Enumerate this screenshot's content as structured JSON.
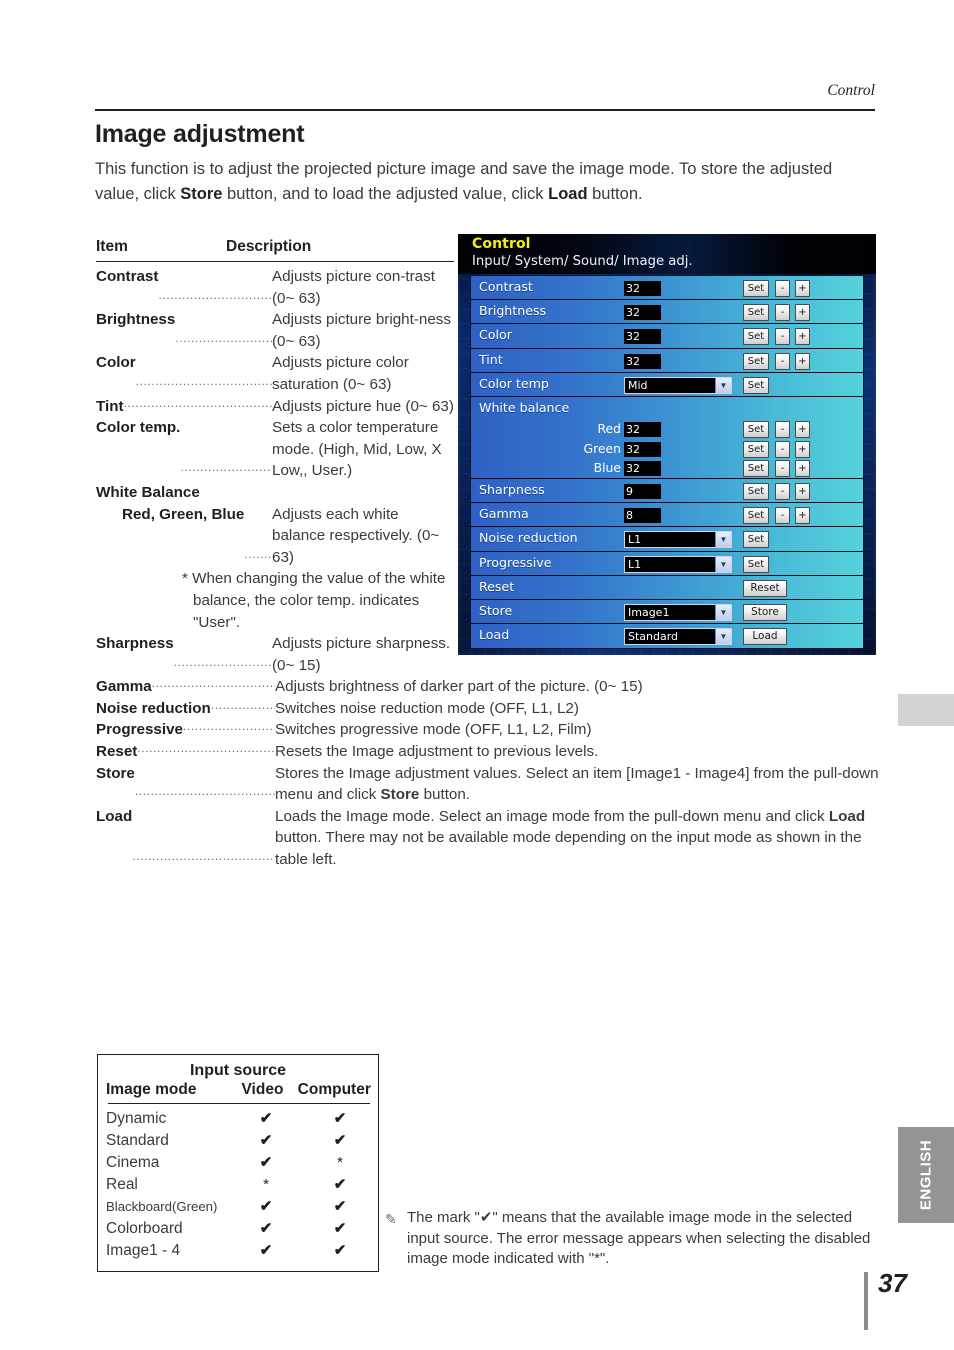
{
  "running_header": "Control",
  "page_title": "Image  adjustment",
  "intro": {
    "part1": "This function is to adjust the projected picture image and save the image mode. To store the adjusted value, click ",
    "store_bold": "Store",
    "part2": " button, and to load the adjusted value, click ",
    "load_bold": "Load",
    "part3": " button."
  },
  "desc_table": {
    "header_item": "Item",
    "header_description": "Description",
    "rows_a": [
      {
        "item": "Contrast",
        "desc": "Adjusts picture con-trast (0~ 63)"
      },
      {
        "item": "Brightness",
        "desc": "Adjusts picture bright-ness (0~ 63)"
      },
      {
        "item": "Color",
        "desc": "Adjusts picture color saturation (0~ 63)"
      },
      {
        "item": "Tint",
        "desc": "Adjusts picture hue (0~ 63)"
      },
      {
        "item": "Color temp.",
        "desc": "Sets a color temperature mode. (High, Mid, Low, X Low,, User.)"
      }
    ],
    "white_balance_head": "White Balance",
    "white_balance_sub_item": "Red, Green, Blue",
    "white_balance_desc": "Adjusts each white balance respectively. (0~ 63)",
    "white_balance_note": "* When changing the value of the white balance, the color temp. indicates \"User\".",
    "rows_b": [
      {
        "item": "Sharpness",
        "desc": "Adjusts picture sharpness. (0~ 15)"
      },
      {
        "item": "Gamma",
        "desc": "Adjusts brightness of darker part of the picture. (0~ 15)"
      },
      {
        "item": "Noise reduction",
        "desc": "Switches noise reduction mode (OFF, L1, L2)"
      },
      {
        "item": "Progressive",
        "desc": "Switches progressive mode (OFF, L1, L2, Film)"
      },
      {
        "item": "Reset",
        "desc": "Resets the Image adjustment to previous levels."
      }
    ],
    "store_row": {
      "item": "Store",
      "part1": "Stores the Image adjustment values. Select an item [Image1 - Image4] from the pull-down menu and click ",
      "bold": "Store",
      "part2": " button."
    },
    "load_row": {
      "item": "Load",
      "part1": "Loads the Image mode. Select an image mode from the pull-down menu and click ",
      "bold": "Load",
      "part2": " button. There may not be available mode depending on the input mode as shown in the table left."
    }
  },
  "panel": {
    "title": "Control",
    "subtitle": "Input/ System/ Sound/ Image adj.",
    "set_label": "Set",
    "minus_label": "-",
    "plus_label": "+",
    "rows": [
      {
        "label": "Contrast",
        "value": "32"
      },
      {
        "label": "Brightness",
        "value": "32"
      },
      {
        "label": "Color",
        "value": "32"
      },
      {
        "label": "Tint",
        "value": "32"
      }
    ],
    "color_temp": {
      "label": "Color temp",
      "value": "Mid"
    },
    "white_balance": {
      "label": "White balance",
      "channels": [
        {
          "label": "Red",
          "value": "32"
        },
        {
          "label": "Green",
          "value": "32"
        },
        {
          "label": "Blue",
          "value": "32"
        }
      ]
    },
    "sharpness": {
      "label": "Sharpness",
      "value": "9"
    },
    "gamma": {
      "label": "Gamma",
      "value": "8"
    },
    "noise_reduction": {
      "label": "Noise reduction",
      "value": "L1"
    },
    "progressive": {
      "label": "Progressive",
      "value": "L1"
    },
    "reset": {
      "label": "Reset",
      "button": "Reset"
    },
    "store": {
      "label": "Store",
      "value": "Image1",
      "button": "Store"
    },
    "load": {
      "label": "Load",
      "value": "Standard",
      "button": "Load"
    }
  },
  "source_table": {
    "title": "Input source",
    "col_mode": "Image mode",
    "col_video": "Video",
    "col_computer": "Computer",
    "check": "✔",
    "star": "*",
    "rows": [
      {
        "mode": "Dynamic",
        "video": "✔",
        "computer": "✔",
        "small": false
      },
      {
        "mode": "Standard",
        "video": "✔",
        "computer": "✔",
        "small": false
      },
      {
        "mode": "Cinema",
        "video": "✔",
        "computer": "*",
        "small": false
      },
      {
        "mode": "Real",
        "video": "*",
        "computer": "✔",
        "small": false
      },
      {
        "mode": "Blackboard(Green)",
        "video": "✔",
        "computer": "✔",
        "small": true
      },
      {
        "mode": "Colorboard",
        "video": "✔",
        "computer": "✔",
        "small": false
      },
      {
        "mode": "Image1 - 4",
        "video": "✔",
        "computer": "✔",
        "small": false
      }
    ]
  },
  "footnote": {
    "icon": "pencil-note-icon",
    "text": "The mark \"✔\" means that the available image mode in the selected input source. The error message appears when selecting the disabled image mode indicated with \"*\"."
  },
  "language_tab": "ENGLISH",
  "page_number": "37"
}
